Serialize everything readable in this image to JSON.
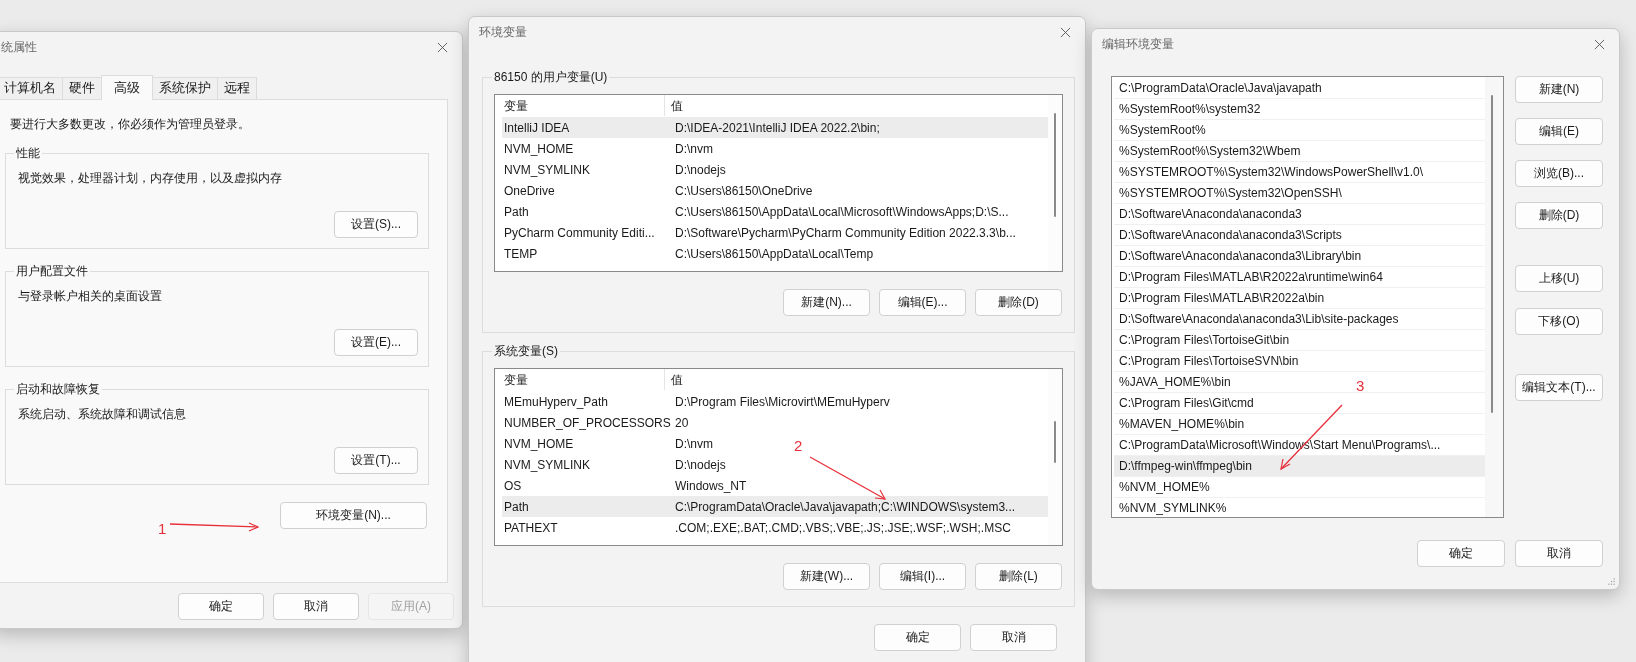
{
  "system_properties": {
    "title": "统属性",
    "tabs": [
      {
        "label": "计算机名",
        "selected": false
      },
      {
        "label": "硬件",
        "selected": false
      },
      {
        "label": "高级",
        "selected": true
      },
      {
        "label": "系统保护",
        "selected": false
      },
      {
        "label": "远程",
        "selected": false
      }
    ],
    "notice": "要进行大多数更改，你必须作为管理员登录。",
    "groups": [
      {
        "title": "性能",
        "description": "视觉效果，处理器计划，内存使用，以及虚拟内存",
        "button": "设置(S)..."
      },
      {
        "title": "用户配置文件",
        "description": "与登录帐户相关的桌面设置",
        "button": "设置(E)..."
      },
      {
        "title": "启动和故障恢复",
        "description": "系统启动、系统故障和调试信息",
        "button": "设置(T)..."
      }
    ],
    "env_button": "环境变量(N)...",
    "buttons": [
      {
        "label": "确定",
        "disabled": false
      },
      {
        "label": "取消",
        "disabled": false
      },
      {
        "label": "应用(A)",
        "disabled": true
      }
    ]
  },
  "environment_variables": {
    "title": "环境变量",
    "user_group": {
      "title": "86150 的用户变量(U)",
      "columns": [
        "变量",
        "值"
      ],
      "rows": [
        {
          "name": "IntelliJ IDEA",
          "value": "D:\\IDEA-2021\\IntelliJ IDEA 2022.2\\bin;",
          "selected": true
        },
        {
          "name": "NVM_HOME",
          "value": "D:\\nvm",
          "selected": false
        },
        {
          "name": "NVM_SYMLINK",
          "value": "D:\\nodejs",
          "selected": false
        },
        {
          "name": "OneDrive",
          "value": "C:\\Users\\86150\\OneDrive",
          "selected": false
        },
        {
          "name": "Path",
          "value": "C:\\Users\\86150\\AppData\\Local\\Microsoft\\WindowsApps;D:\\S...",
          "selected": false
        },
        {
          "name": "PyCharm Community Editi...",
          "value": "D:\\Software\\Pycharm\\PyCharm Community Edition 2022.3.3\\b...",
          "selected": false
        },
        {
          "name": "TEMP",
          "value": "C:\\Users\\86150\\AppData\\Local\\Temp",
          "selected": false
        }
      ],
      "buttons": [
        "新建(N)...",
        "编辑(E)...",
        "删除(D)"
      ]
    },
    "system_group": {
      "title": "系统变量(S)",
      "columns": [
        "变量",
        "值"
      ],
      "rows": [
        {
          "name": "MEmuHyperv_Path",
          "value": "D:\\Program Files\\Microvirt\\MEmuHyperv",
          "selected": false
        },
        {
          "name": "NUMBER_OF_PROCESSORS",
          "value": "20",
          "selected": false
        },
        {
          "name": "NVM_HOME",
          "value": "D:\\nvm",
          "selected": false
        },
        {
          "name": "NVM_SYMLINK",
          "value": "D:\\nodejs",
          "selected": false
        },
        {
          "name": "OS",
          "value": "Windows_NT",
          "selected": false
        },
        {
          "name": "Path",
          "value": "C:\\ProgramData\\Oracle\\Java\\javapath;C:\\WINDOWS\\system3...",
          "selected": true
        },
        {
          "name": "PATHEXT",
          "value": ".COM;.EXE;.BAT;.CMD;.VBS;.VBE;.JS;.JSE;.WSF;.WSH;.MSC",
          "selected": false
        }
      ],
      "buttons": [
        "新建(W)...",
        "编辑(I)...",
        "删除(L)"
      ]
    },
    "buttons": [
      "确定",
      "取消"
    ]
  },
  "edit_environment_variable": {
    "title": "编辑环境变量",
    "entries": [
      {
        "text": "C:\\ProgramData\\Oracle\\Java\\javapath",
        "selected": false
      },
      {
        "text": "%SystemRoot%\\system32",
        "selected": false
      },
      {
        "text": "%SystemRoot%",
        "selected": false
      },
      {
        "text": "%SystemRoot%\\System32\\Wbem",
        "selected": false
      },
      {
        "text": "%SYSTEMROOT%\\System32\\WindowsPowerShell\\v1.0\\",
        "selected": false
      },
      {
        "text": "%SYSTEMROOT%\\System32\\OpenSSH\\",
        "selected": false
      },
      {
        "text": "D:\\Software\\Anaconda\\anaconda3",
        "selected": false
      },
      {
        "text": "D:\\Software\\Anaconda\\anaconda3\\Scripts",
        "selected": false
      },
      {
        "text": "D:\\Software\\Anaconda\\anaconda3\\Library\\bin",
        "selected": false
      },
      {
        "text": "D:\\Program Files\\MATLAB\\R2022a\\runtime\\win64",
        "selected": false
      },
      {
        "text": "D:\\Program Files\\MATLAB\\R2022a\\bin",
        "selected": false
      },
      {
        "text": "D:\\Software\\Anaconda\\anaconda3\\Lib\\site-packages",
        "selected": false
      },
      {
        "text": "C:\\Program Files\\TortoiseGit\\bin",
        "selected": false
      },
      {
        "text": "C:\\Program Files\\TortoiseSVN\\bin",
        "selected": false
      },
      {
        "text": "%JAVA_HOME%\\bin",
        "selected": false
      },
      {
        "text": "C:\\Program Files\\Git\\cmd",
        "selected": false
      },
      {
        "text": "%MAVEN_HOME%\\bin",
        "selected": false
      },
      {
        "text": "C:\\ProgramData\\Microsoft\\Windows\\Start Menu\\Programs\\...",
        "selected": false
      },
      {
        "text": "D:\\ffmpeg-win\\ffmpeg\\bin",
        "selected": true
      },
      {
        "text": "%NVM_HOME%",
        "selected": false
      },
      {
        "text": "%NVM_SYMLINK%",
        "selected": false
      }
    ],
    "side_buttons": [
      "新建(N)",
      "编辑(E)",
      "浏览(B)...",
      "删除(D)",
      "上移(U)",
      "下移(O)",
      "编辑文本(T)..."
    ],
    "buttons": [
      "确定",
      "取消"
    ]
  },
  "annotations": [
    {
      "label": "1"
    },
    {
      "label": "2"
    },
    {
      "label": "3"
    }
  ]
}
